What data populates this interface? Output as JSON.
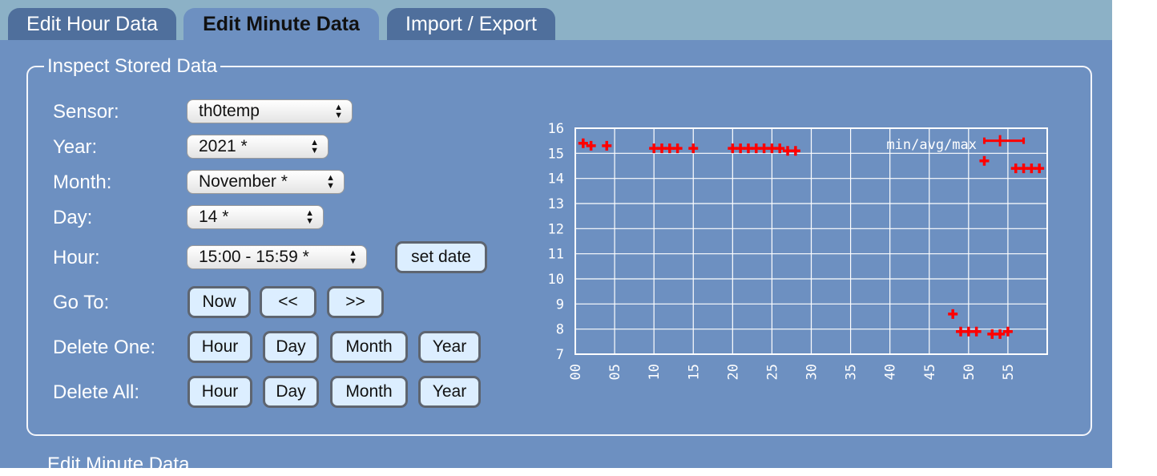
{
  "tabs": [
    {
      "label": "Edit Hour Data"
    },
    {
      "label": "Edit Minute Data"
    },
    {
      "label": "Import / Export"
    }
  ],
  "panel": {
    "legend": "Inspect Stored Data",
    "labels": {
      "sensor": "Sensor:",
      "year": "Year:",
      "month": "Month:",
      "day": "Day:",
      "hour": "Hour:",
      "goto": "Go To:",
      "delete_one": "Delete One:",
      "delete_all": "Delete All:"
    },
    "selects": {
      "sensor": "th0temp",
      "year": "2021 *",
      "month": "November *",
      "day": "14 *",
      "hour": "15:00 - 15:59 *"
    },
    "buttons": {
      "set_date": "set date",
      "now": "Now",
      "back": "<<",
      "forward": ">>",
      "delete_one": [
        "Hour",
        "Day",
        "Month",
        "Year"
      ],
      "delete_all": [
        "Hour",
        "Day",
        "Month",
        "Year"
      ]
    }
  },
  "next_section_label": "Edit Minute Data",
  "chart_data": {
    "type": "scatter",
    "legend": "min/avg/max",
    "legend_position": "top-right",
    "marker": "plus",
    "marker_color": "#ff0000",
    "x_ticks": [
      "00",
      "05",
      "10",
      "15",
      "20",
      "25",
      "30",
      "35",
      "40",
      "45",
      "50",
      "55"
    ],
    "y_ticks": [
      "7",
      "8",
      "9",
      "10",
      "11",
      "12",
      "13",
      "14",
      "15",
      "16"
    ],
    "xlim": [
      0,
      60
    ],
    "ylim": [
      7,
      16
    ],
    "grid": true,
    "points": [
      {
        "x": 1,
        "y": 15.4
      },
      {
        "x": 2,
        "y": 15.3
      },
      {
        "x": 4,
        "y": 15.3
      },
      {
        "x": 10,
        "y": 15.2
      },
      {
        "x": 11,
        "y": 15.2
      },
      {
        "x": 12,
        "y": 15.2
      },
      {
        "x": 13,
        "y": 15.2
      },
      {
        "x": 15,
        "y": 15.2
      },
      {
        "x": 20,
        "y": 15.2
      },
      {
        "x": 21,
        "y": 15.2
      },
      {
        "x": 22,
        "y": 15.2
      },
      {
        "x": 23,
        "y": 15.2
      },
      {
        "x": 24,
        "y": 15.2
      },
      {
        "x": 25,
        "y": 15.2
      },
      {
        "x": 26,
        "y": 15.2
      },
      {
        "x": 27,
        "y": 15.1
      },
      {
        "x": 28,
        "y": 15.1
      },
      {
        "x": 48,
        "y": 8.6
      },
      {
        "x": 49,
        "y": 7.9
      },
      {
        "x": 50,
        "y": 7.9
      },
      {
        "x": 51,
        "y": 7.9
      },
      {
        "x": 52,
        "y": 14.7
      },
      {
        "x": 53,
        "y": 7.8
      },
      {
        "x": 54,
        "y": 7.8
      },
      {
        "x": 55,
        "y": 7.9
      },
      {
        "x": 56,
        "y": 14.4
      },
      {
        "x": 57,
        "y": 14.4
      },
      {
        "x": 58,
        "y": 14.4
      },
      {
        "x": 59,
        "y": 14.4
      }
    ],
    "ranges": [
      {
        "x": 54,
        "min": 15.5,
        "avg": 15.5,
        "max": 15.5,
        "xmin": 52,
        "xmax": 57
      }
    ]
  }
}
